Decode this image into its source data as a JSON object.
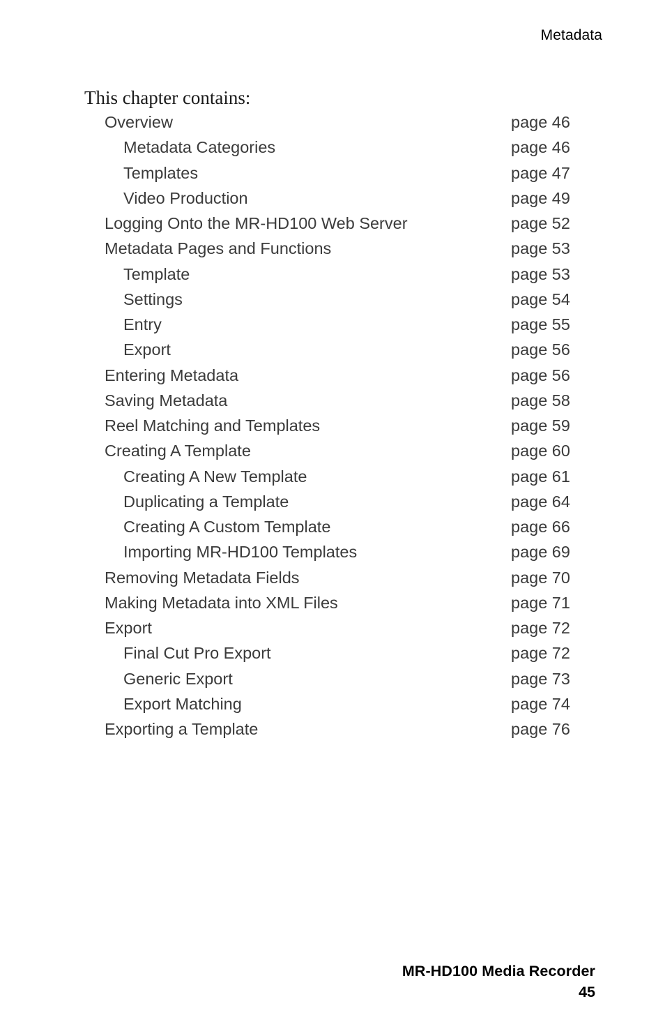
{
  "header": {
    "chapter_title": "Metadata"
  },
  "intro": {
    "text": "This chapter contains:"
  },
  "toc": {
    "entries": [
      {
        "title": "Overview",
        "page": "page 46",
        "level": 1
      },
      {
        "title": "Metadata Categories",
        "page": "page 46",
        "level": 2
      },
      {
        "title": "Templates",
        "page": "page 47",
        "level": 2
      },
      {
        "title": "Video Production",
        "page": "page 49",
        "level": 2
      },
      {
        "title": "Logging Onto the MR-HD100 Web Server",
        "page": "page 52",
        "level": 1
      },
      {
        "title": "Metadata Pages and Functions",
        "page": "page 53",
        "level": 1
      },
      {
        "title": "Template",
        "page": "page 53",
        "level": 2
      },
      {
        "title": "Settings",
        "page": "page 54",
        "level": 2
      },
      {
        "title": "Entry",
        "page": "page 55",
        "level": 2
      },
      {
        "title": "Export",
        "page": "page 56",
        "level": 2
      },
      {
        "title": "Entering Metadata",
        "page": "page 56",
        "level": 1
      },
      {
        "title": "Saving Metadata",
        "page": "page 58",
        "level": 1
      },
      {
        "title": "Reel Matching and Templates",
        "page": "page 59",
        "level": 1
      },
      {
        "title": "Creating A Template",
        "page": "page 60",
        "level": 1
      },
      {
        "title": "Creating A New Template",
        "page": "page 61",
        "level": 2
      },
      {
        "title": "Duplicating a Template",
        "page": "page 64",
        "level": 2
      },
      {
        "title": "Creating A Custom Template",
        "page": "page 66",
        "level": 2
      },
      {
        "title": "Importing MR-HD100 Templates",
        "page": "page 69",
        "level": 2
      },
      {
        "title": "Removing Metadata Fields",
        "page": "page 70",
        "level": 1
      },
      {
        "title": "Making Metadata into XML Files",
        "page": "page 71",
        "level": 1
      },
      {
        "title": "Export",
        "page": "page 72",
        "level": 1
      },
      {
        "title": "Final Cut Pro Export",
        "page": "page 72",
        "level": 2
      },
      {
        "title": "Generic Export",
        "page": "page 73",
        "level": 2
      },
      {
        "title": "Export Matching",
        "page": "page 74",
        "level": 2
      },
      {
        "title": "Exporting a Template",
        "page": "page 76",
        "level": 1
      }
    ]
  },
  "footer": {
    "product": "MR-HD100 Media Recorder",
    "page_number": "45"
  },
  "colors": {
    "text_primary": "#000000",
    "text_toc": "#3b3b3b",
    "background": "#ffffff"
  }
}
